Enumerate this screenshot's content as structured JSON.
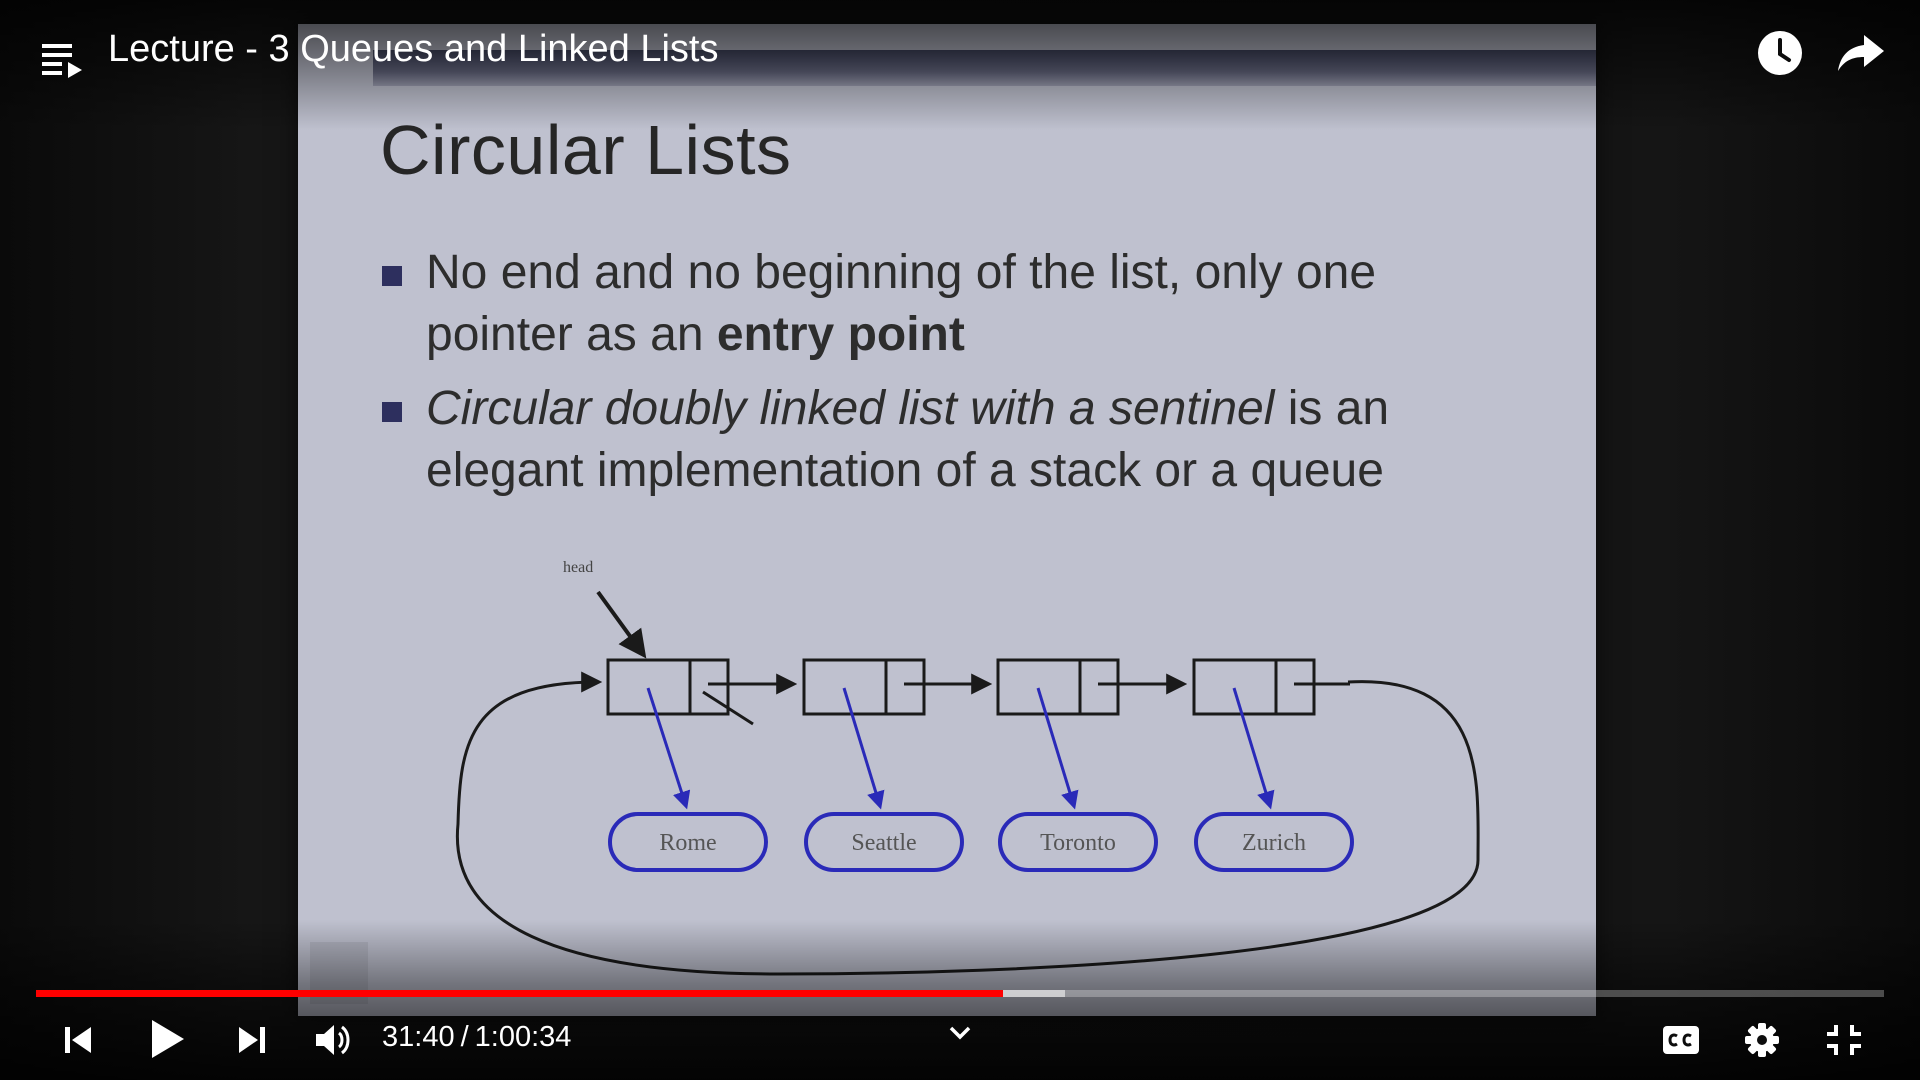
{
  "player": {
    "title": "Lecture - 3 Queues and Linked Lists",
    "time": {
      "current": "31:40",
      "separator": "/",
      "duration": "1:00:34"
    },
    "progress": {
      "played_fraction": 0.523,
      "buffered_fraction": 0.557
    },
    "accent_color": "#ff0000",
    "icons": {
      "playlist": "playlist-icon",
      "watch_later": "clock-icon",
      "share": "share-icon",
      "previous": "skip-previous-icon",
      "play": "play-icon",
      "next": "skip-next-icon",
      "volume": "volume-icon",
      "chapter_expand": "chevron-down-icon",
      "captions": "cc-icon",
      "settings": "gear-icon",
      "exit_fullscreen": "exit-fullscreen-icon"
    }
  },
  "slide": {
    "title": "Circular Lists",
    "bullet1": {
      "text_a": "No end and no beginning of the list, only one pointer as an ",
      "text_bold": "entry point"
    },
    "bullet2": {
      "text_italic": "Circular doubly linked list with a sentinel",
      "text_b": " is an elegant implementation of a stack or a queue"
    },
    "diagram": {
      "head_label": "head",
      "nodes": [
        "Rome",
        "Seattle",
        "Toronto",
        "Zurich"
      ]
    }
  }
}
